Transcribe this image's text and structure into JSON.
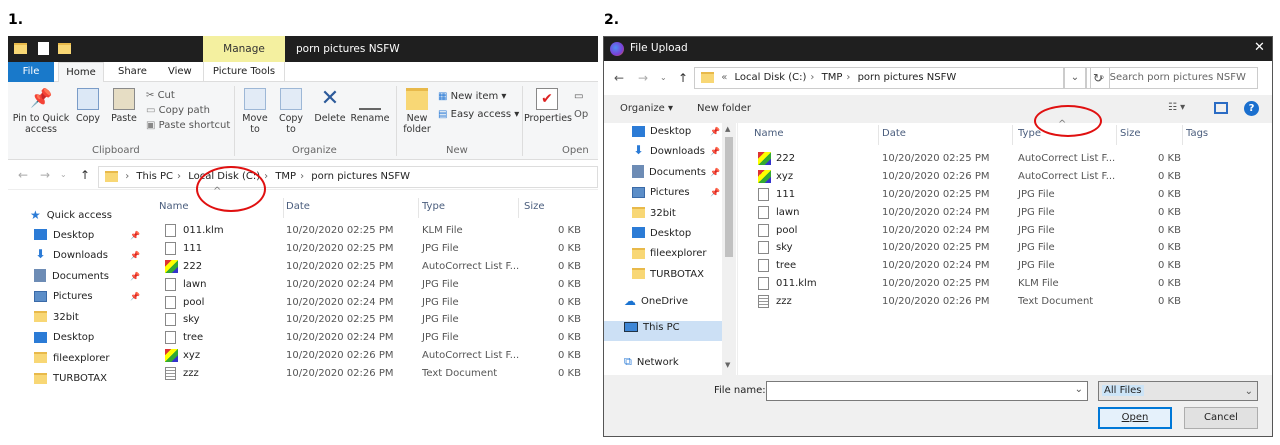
{
  "panel1": {
    "number": "1.",
    "title": "porn pictures NSFW",
    "manage_tab": "Manage",
    "picture_tools": "Picture Tools",
    "tabs": [
      "File",
      "Home",
      "Share",
      "View"
    ],
    "ribbon": {
      "pin_label": "Pin to Quick access",
      "copy": "Copy",
      "paste": "Paste",
      "cut": "Cut",
      "copy_path": "Copy path",
      "paste_shortcut": "Paste shortcut",
      "move_to": "Move to",
      "copy_to": "Copy to",
      "delete": "Delete",
      "rename": "Rename",
      "new_folder": "New folder",
      "new_item": "New item",
      "easy_access": "Easy access",
      "properties": "Properties",
      "open_partial": "Op",
      "groups": [
        "Clipboard",
        "Organize",
        "New",
        "Open"
      ]
    },
    "breadcrumb": [
      "This PC",
      "Local Disk (C:)",
      "TMP",
      "porn pictures NSFW"
    ],
    "columns": [
      "Name",
      "Date",
      "Type",
      "Size"
    ],
    "nav": [
      {
        "label": "Quick access",
        "icon": "star-icon"
      },
      {
        "label": "Desktop",
        "icon": "desktop-icon",
        "pin": true
      },
      {
        "label": "Downloads",
        "icon": "download-icon",
        "pin": true
      },
      {
        "label": "Documents",
        "icon": "documents-icon",
        "pin": true
      },
      {
        "label": "Pictures",
        "icon": "pictures-icon",
        "pin": true
      },
      {
        "label": "32bit",
        "icon": "folder-icon"
      },
      {
        "label": "Desktop",
        "icon": "desktop-icon"
      },
      {
        "label": "fileexplorer",
        "icon": "folder-icon"
      },
      {
        "label": "TURBOTAX",
        "icon": "folder-icon"
      }
    ],
    "files": [
      {
        "name": "011.klm",
        "date": "10/20/2020 02:25 PM",
        "type": "KLM File",
        "size": "0 KB",
        "icon": "file"
      },
      {
        "name": "111",
        "date": "10/20/2020 02:25 PM",
        "type": "JPG File",
        "size": "0 KB",
        "icon": "file"
      },
      {
        "name": "222",
        "date": "10/20/2020 02:25 PM",
        "type": "AutoCorrect List F...",
        "size": "0 KB",
        "icon": "ac"
      },
      {
        "name": "lawn",
        "date": "10/20/2020 02:24 PM",
        "type": "JPG File",
        "size": "0 KB",
        "icon": "file"
      },
      {
        "name": "pool",
        "date": "10/20/2020 02:24 PM",
        "type": "JPG File",
        "size": "0 KB",
        "icon": "file"
      },
      {
        "name": "sky",
        "date": "10/20/2020 02:25 PM",
        "type": "JPG File",
        "size": "0 KB",
        "icon": "file"
      },
      {
        "name": "tree",
        "date": "10/20/2020 02:24 PM",
        "type": "JPG File",
        "size": "0 KB",
        "icon": "file"
      },
      {
        "name": "xyz",
        "date": "10/20/2020 02:26 PM",
        "type": "AutoCorrect List F...",
        "size": "0 KB",
        "icon": "ac"
      },
      {
        "name": "zzz",
        "date": "10/20/2020 02:26 PM",
        "type": "Text Document",
        "size": "0 KB",
        "icon": "txt"
      }
    ]
  },
  "panel2": {
    "number": "2.",
    "title": "File Upload",
    "breadcrumb": [
      "Local Disk (C:)",
      "TMP",
      "porn pictures NSFW"
    ],
    "search_placeholder": "Search porn pictures NSFW",
    "organize": "Organize",
    "new_folder": "New folder",
    "columns": [
      "Name",
      "Date",
      "Type",
      "Size",
      "Tags"
    ],
    "nav": [
      {
        "label": "Desktop",
        "icon": "desktop-icon",
        "pin": true
      },
      {
        "label": "Downloads",
        "icon": "download-icon",
        "pin": true
      },
      {
        "label": "Documents",
        "icon": "documents-icon",
        "pin": true
      },
      {
        "label": "Pictures",
        "icon": "pictures-icon",
        "pin": true
      },
      {
        "label": "32bit",
        "icon": "folder-icon"
      },
      {
        "label": "Desktop",
        "icon": "desktop-icon"
      },
      {
        "label": "fileexplorer",
        "icon": "folder-icon"
      },
      {
        "label": "TURBOTAX",
        "icon": "folder-icon"
      },
      {
        "label": "OneDrive",
        "icon": "cloud-icon"
      },
      {
        "label": "This PC",
        "icon": "pc-icon"
      },
      {
        "label": "Network",
        "icon": "network-icon"
      }
    ],
    "files": [
      {
        "name": "222",
        "date": "10/20/2020 02:25 PM",
        "type": "AutoCorrect List F...",
        "size": "0 KB",
        "icon": "ac"
      },
      {
        "name": "xyz",
        "date": "10/20/2020 02:26 PM",
        "type": "AutoCorrect List F...",
        "size": "0 KB",
        "icon": "ac"
      },
      {
        "name": "111",
        "date": "10/20/2020 02:25 PM",
        "type": "JPG File",
        "size": "0 KB",
        "icon": "file"
      },
      {
        "name": "lawn",
        "date": "10/20/2020 02:24 PM",
        "type": "JPG File",
        "size": "0 KB",
        "icon": "file"
      },
      {
        "name": "pool",
        "date": "10/20/2020 02:24 PM",
        "type": "JPG File",
        "size": "0 KB",
        "icon": "file"
      },
      {
        "name": "sky",
        "date": "10/20/2020 02:25 PM",
        "type": "JPG File",
        "size": "0 KB",
        "icon": "file"
      },
      {
        "name": "tree",
        "date": "10/20/2020 02:24 PM",
        "type": "JPG File",
        "size": "0 KB",
        "icon": "file"
      },
      {
        "name": "011.klm",
        "date": "10/20/2020 02:25 PM",
        "type": "KLM File",
        "size": "0 KB",
        "icon": "file"
      },
      {
        "name": "zzz",
        "date": "10/20/2020 02:26 PM",
        "type": "Text Document",
        "size": "0 KB",
        "icon": "txt"
      }
    ],
    "file_name_label": "File name:",
    "file_type": "All Files",
    "open": "Open",
    "cancel": "Cancel"
  }
}
